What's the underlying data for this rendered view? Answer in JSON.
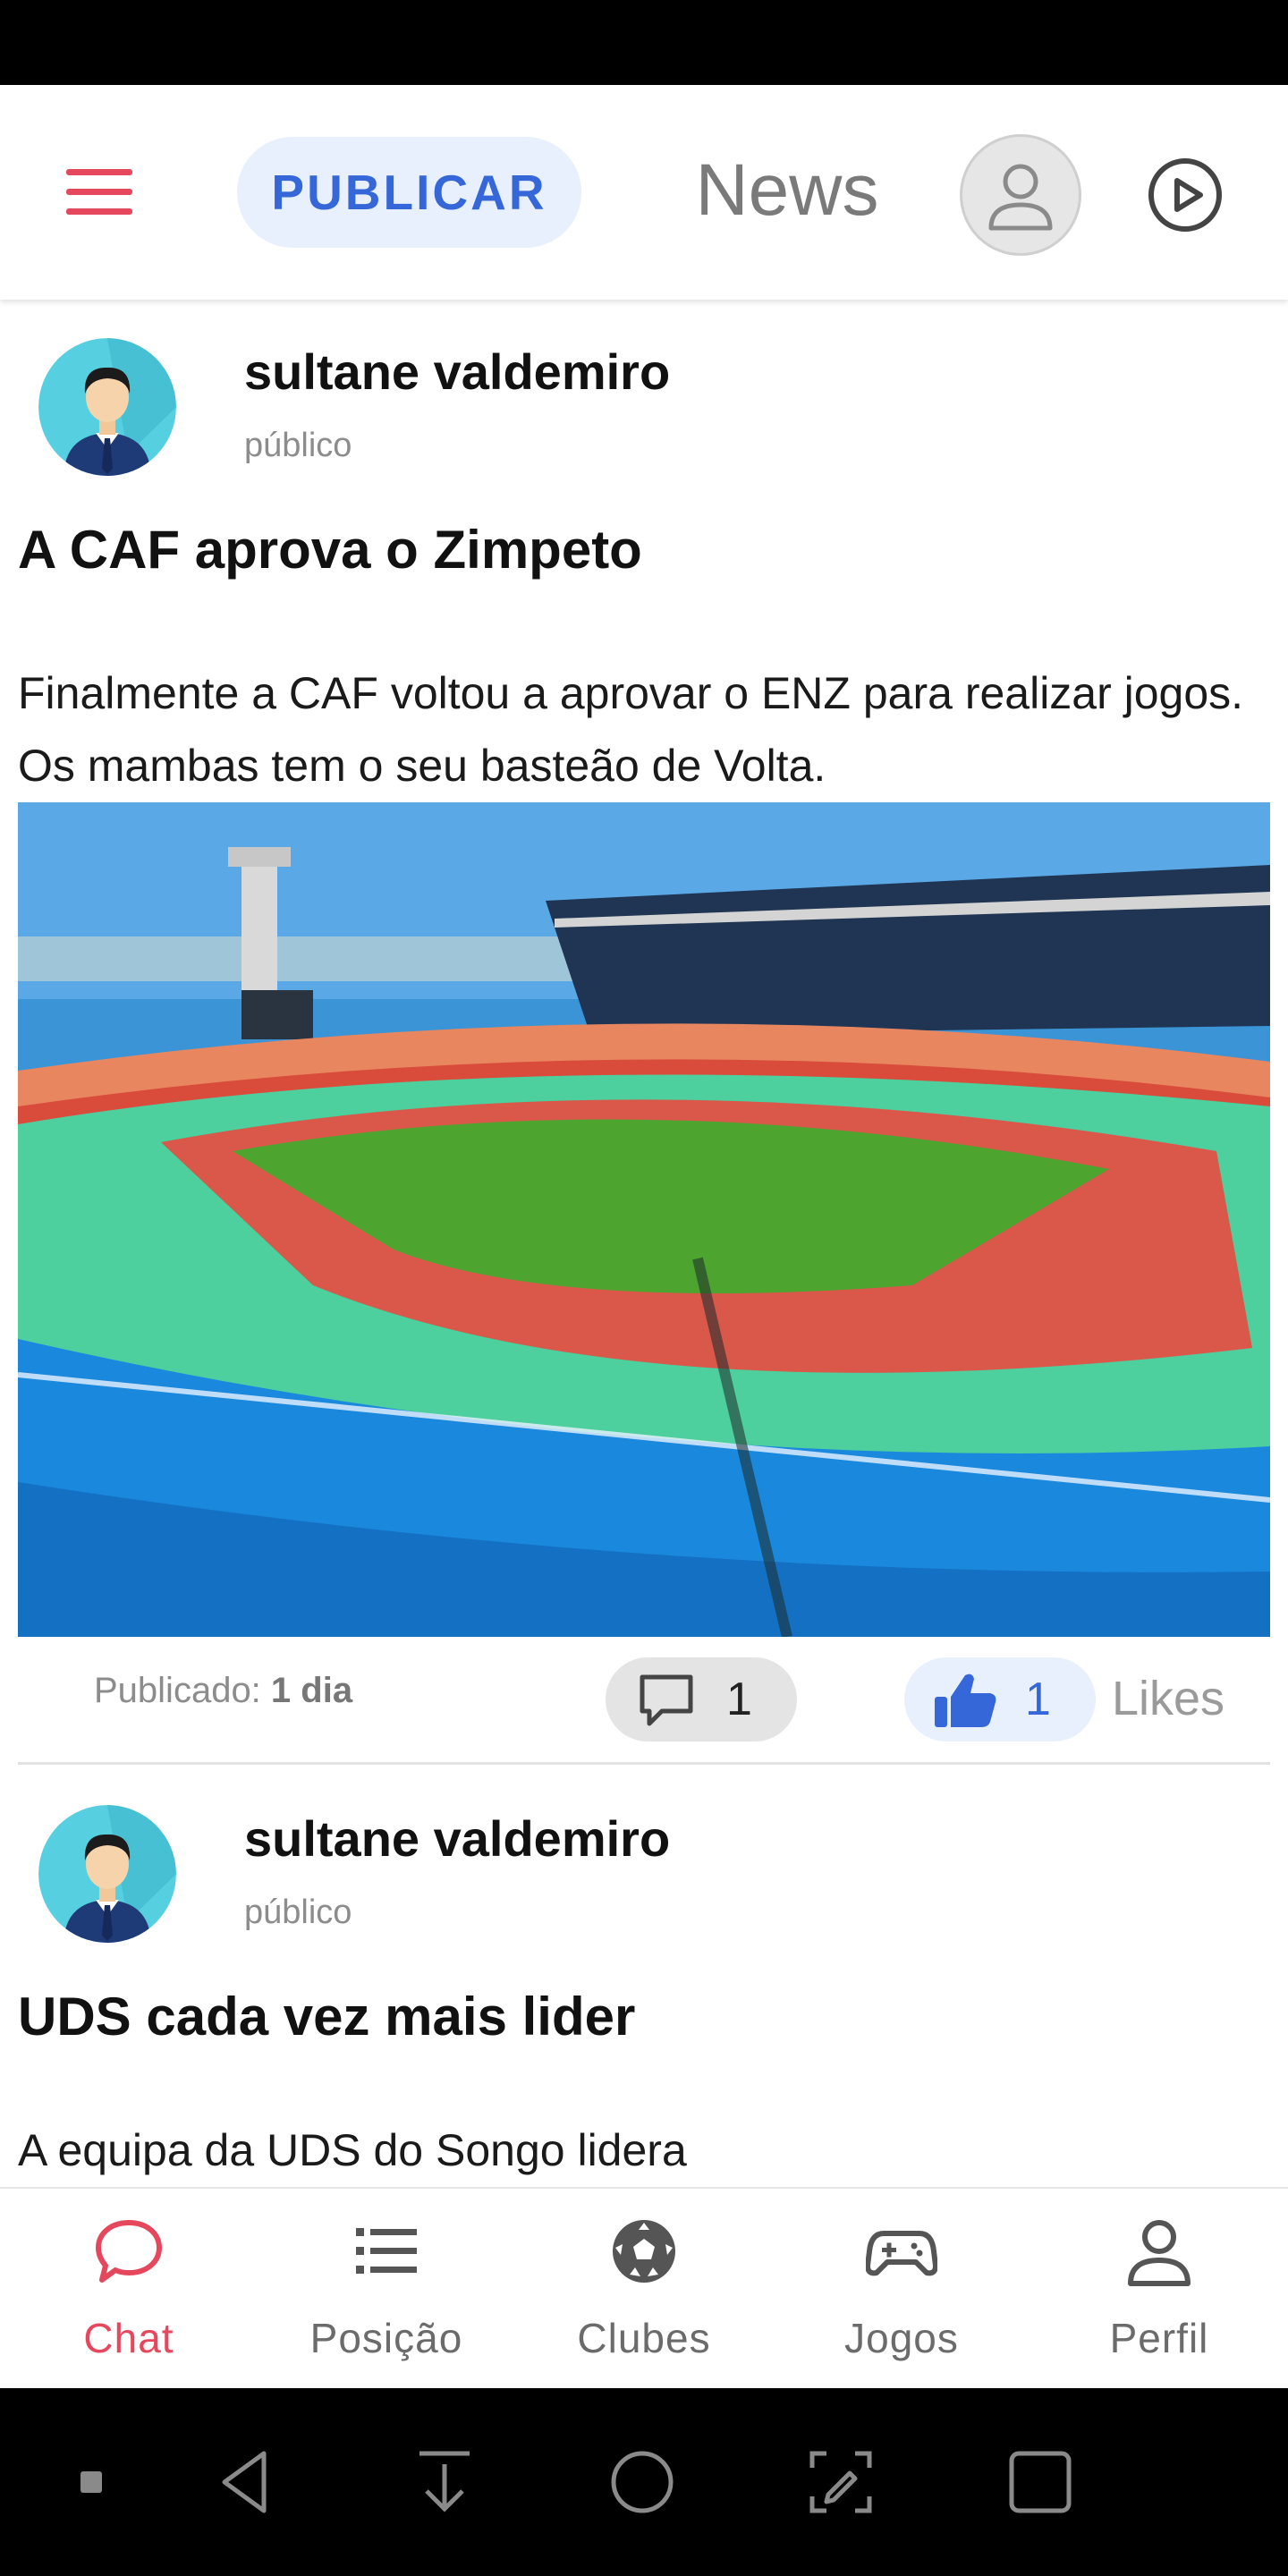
{
  "header": {
    "publish_label": "PUBLICAR",
    "title": "News",
    "icons": [
      "menu-icon",
      "user-icon",
      "play-circle-icon"
    ],
    "accent_color": "#e5475d",
    "publish_bg": "#e8f0fd",
    "publish_color": "#3567d8"
  },
  "posts": [
    {
      "author": "sultane valdemiro",
      "visibility": "público",
      "title": "A CAF aprova o Zimpeto",
      "body": "Finalmente a CAF voltou a aprovar o ENZ para realizar jogos.  Os mambas tem o seu basteão de Volta.",
      "published_label": "Publicado:",
      "published_value": "1 dia",
      "comments": "1",
      "likes": "1",
      "likes_label": "Likes"
    },
    {
      "author": "sultane valdemiro",
      "visibility": "público",
      "title": "UDS cada vez mais lider",
      "teaser": "A equipa da UDS do Songo lidera"
    }
  ],
  "bottom_nav": {
    "items": [
      {
        "label": "Chat",
        "icon": "chat-icon",
        "active": true
      },
      {
        "label": "Posição",
        "icon": "list-icon"
      },
      {
        "label": "Clubes",
        "icon": "soccer-ball-icon"
      },
      {
        "label": "Jogos",
        "icon": "gamepad-icon"
      },
      {
        "label": "Perfil",
        "icon": "person-icon"
      }
    ],
    "active_color": "#e5475d"
  },
  "system_nav": {
    "icons": [
      "dot-icon",
      "back-icon",
      "download-icon",
      "home-icon",
      "screenshot-edit-icon",
      "recents-icon"
    ]
  }
}
